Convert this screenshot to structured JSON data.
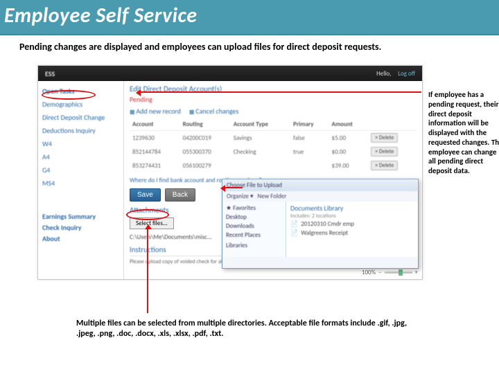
{
  "title": "Employee Self Service",
  "subtitle": "Pending changes are displayed and employees can upload files for direct deposit requests.",
  "header": {
    "brand": "ESS",
    "hello": "Hello,",
    "logoff": "Log off"
  },
  "sidebar": {
    "open_tasks": "Open Tasks",
    "items": [
      "Demographics",
      "Direct Deposit Change",
      "Deductions Inquiry",
      "W4",
      "A4",
      "G4",
      "MS4"
    ],
    "earnings": "Earnings Summary",
    "check": "Check Inquiry",
    "about": "About"
  },
  "main": {
    "page_title": "Edit Direct Deposit Account(s)",
    "pending": "Pending",
    "toolbar": {
      "add": "Add new record",
      "cancel": "Cancel changes"
    },
    "table": {
      "headers": [
        "Account",
        "Routing",
        "Account Type",
        "Primary",
        "Amount",
        ""
      ],
      "rows": [
        [
          "1239630",
          "04200C019",
          "Savings",
          "false",
          "$5.00",
          "× Delete"
        ],
        [
          "852144784",
          "055300370",
          "Checking",
          "true",
          "$0.00",
          "× Delete"
        ],
        [
          "853274431",
          "056100279",
          "",
          "",
          "$39.00",
          "× Delete"
        ]
      ]
    },
    "help_link": "Where do I find bank account and routing numbers?",
    "save": "Save",
    "back": "Back",
    "attachments": "Attachments",
    "select_files": "Select files...",
    "path": "C:\\Users\\Me\\Documents\\misc...",
    "instructions_title": "Instructions",
    "instructions_text": "Please upload copy of voided check for all new direct deposit records for verification of information."
  },
  "chooser": {
    "title": "Choose File to Upload",
    "organize": "Organize ▾",
    "newfolder": "New Folder",
    "nav": [
      "★ Favorites",
      "  Desktop",
      "  Downloads",
      "  Recent Places",
      "",
      "Libraries"
    ],
    "lib_title": "Documents Library",
    "lib_sub": "Includes: 2 locations",
    "files": [
      "20120310 Cmdr emp",
      "Walgreens Receipt"
    ]
  },
  "zoom": "100%",
  "annotations": {
    "right": "If employee has a pending request, their direct deposit information will be displayed with the requested changes. The employee can change all pending direct deposit data.",
    "bottom": "Multiple files can be selected from multiple directories.  Acceptable file formats include .gif, .jpg, .jpeg, .png, .doc, .docx, .xls, .xlsx, .pdf,  .txt."
  }
}
